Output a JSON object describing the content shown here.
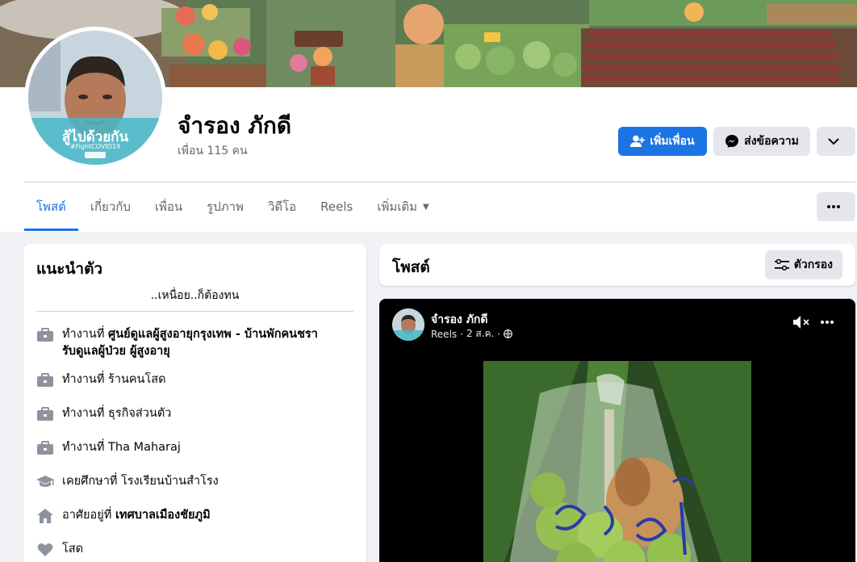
{
  "profile": {
    "name": "จำรอง ภักดี",
    "friends_count": "เพื่อน 115 คน",
    "frame_text": "สู้ไปด้วยกัน",
    "frame_tag": "#FightCOVID19"
  },
  "actions": {
    "add_friend": "เพิ่มเพื่อน",
    "message": "ส่งข้อความ"
  },
  "tabs": [
    {
      "label": "โพสต์",
      "active": true
    },
    {
      "label": "เกี่ยวกับ",
      "active": false
    },
    {
      "label": "เพื่อน",
      "active": false
    },
    {
      "label": "รูปภาพ",
      "active": false
    },
    {
      "label": "วิดีโอ",
      "active": false
    },
    {
      "label": "Reels",
      "active": false
    },
    {
      "label": "เพิ่มเติม",
      "active": false
    }
  ],
  "intro": {
    "title": "แนะนำตัว",
    "bio": "..เหนื่อย..ก็ต้องทน",
    "items": [
      {
        "icon": "briefcase-icon",
        "prefix": "ทำงานที่",
        "value": "ศูนย์ดูแลผู้สูงอายุกรุงเทพ - บ้านพักคนชรา",
        "value_line2": "รับดูแลผู้ป่วย ผู้สูงอายุ",
        "bold": true
      },
      {
        "icon": "briefcase-icon",
        "prefix": "ทำงานที่",
        "value": "ร้านคนโสด",
        "bold": false
      },
      {
        "icon": "briefcase-icon",
        "prefix": "ทำงานที่",
        "value": "ธุรกิจส่วนตัว",
        "bold": false
      },
      {
        "icon": "briefcase-icon",
        "prefix": "ทำงานที่",
        "value": "Tha Maharaj",
        "bold": false
      },
      {
        "icon": "graduation-cap-icon",
        "prefix": "เคยศึกษาที่",
        "value": "โรงเรียนบ้านสำโรง",
        "bold": false
      },
      {
        "icon": "home-icon",
        "prefix": "อาศัยอยู่ที่",
        "value": "เทศบาลเมืองชัยภูมิ",
        "bold": true
      },
      {
        "icon": "heart-icon",
        "prefix": "",
        "value": "โสด",
        "bold": false
      }
    ]
  },
  "posts": {
    "title": "โพสต์",
    "filter_label": "ตัวกรอง"
  },
  "reel_post": {
    "author": "จำรอง ภักดี",
    "type": "Reels",
    "date": "2 ส.ค."
  },
  "colors": {
    "accent": "#1b74e4",
    "background": "#f0f2f5",
    "secondary_button": "#e4e6eb"
  }
}
